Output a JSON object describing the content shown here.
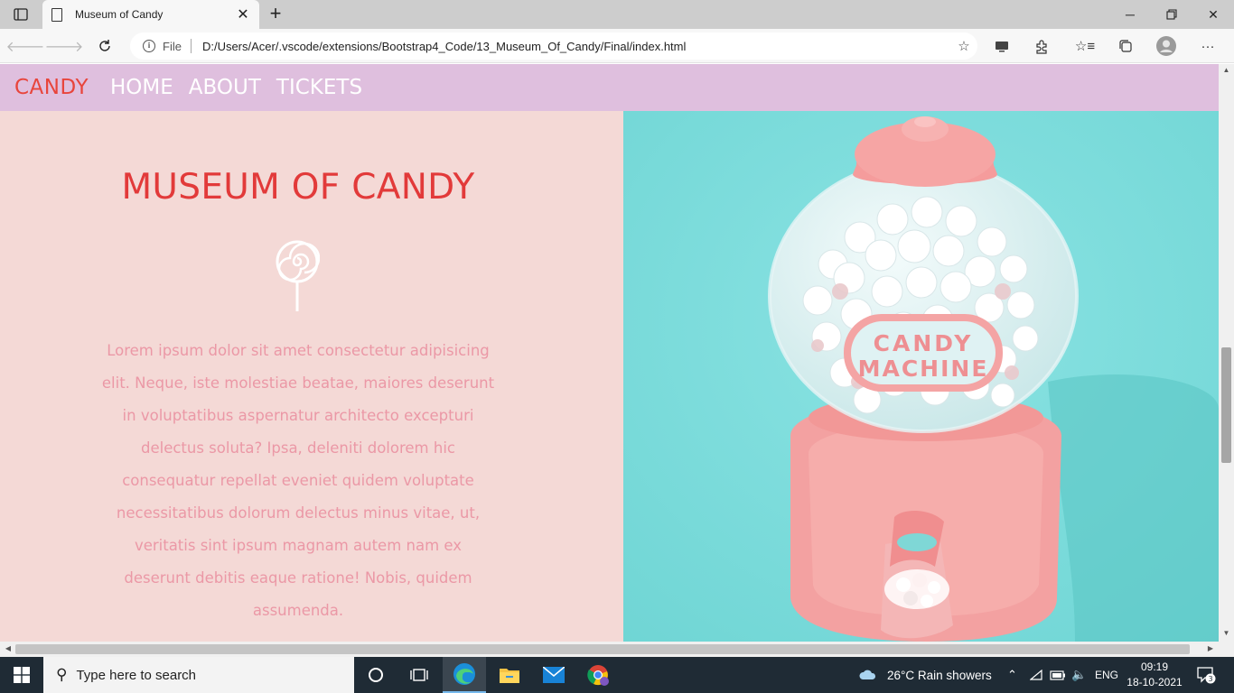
{
  "browser": {
    "tab_title": "Museum of Candy",
    "url_scheme": "File",
    "url": "D:/Users/Acer/.vscode/extensions/Bootstrap4_Code/13_Museum_Of_Candy/Final/index.html"
  },
  "site": {
    "brand": "CANDY",
    "nav": [
      "HOME",
      "ABOUT",
      "TICKETS"
    ],
    "hero_title": "MUSEUM OF CANDY",
    "hero_text": "Lorem ipsum dolor sit amet consectetur adipisicing elit. Neque, iste molestiae beatae, maiores deserunt in voluptatibus aspernatur architecto excepturi delectus soluta? Ipsa, deleniti dolorem hic consequatur repellat eveniet quidem voluptate necessitatibus dolorum delectus minus vitae, ut, veritatis sint ipsum magnam autem nam ex deserunt debitis eaque ratione! Nobis, quidem assumenda.",
    "image_label_line1": "CANDY",
    "image_label_line2": "MACHINE",
    "colors": {
      "nav_bg": "#dfbfde",
      "brand": "#e8453c",
      "left_bg": "#f4d9d6",
      "title": "#e23a3a",
      "body_text": "#eb98a6",
      "image_bg": "#7fdcdc",
      "machine_pink": "#f59c9c"
    }
  },
  "taskbar": {
    "search_placeholder": "Type here to search",
    "weather": "26°C  Rain showers",
    "language": "ENG",
    "time": "09:19",
    "date": "18-10-2021",
    "notification_count": "3"
  }
}
